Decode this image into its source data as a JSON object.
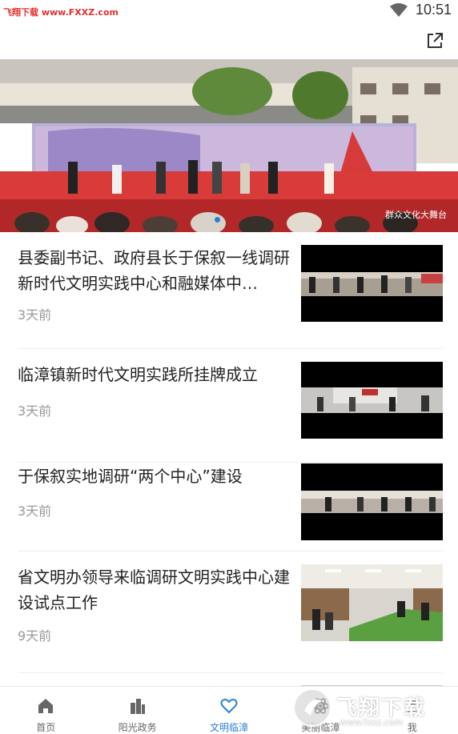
{
  "status_bar": {
    "watermark": "飞翔下载 www.FXXZ.com",
    "time": "10:51"
  },
  "banner": {
    "caption": "群众文化大舞台",
    "slides": 2,
    "active_slide": 0
  },
  "news": [
    {
      "title": "县委副书记、政府县长于保叙一线调研新时代文明实践中心和融媒体中…",
      "time": "3天前"
    },
    {
      "title": "临漳镇新时代文明实践所挂牌成立",
      "time": "3天前"
    },
    {
      "title": "于保叙实地调研“两个中心”建设",
      "time": "3天前"
    },
    {
      "title": "省文明办领导来临调研文明实践中心建设试点工作",
      "time": "9天前"
    }
  ],
  "tabs": [
    {
      "label": "首页",
      "icon": "home-icon"
    },
    {
      "label": "阳光政务",
      "icon": "buildings-icon"
    },
    {
      "label": "文明临漳",
      "icon": "heart-icon",
      "active": true
    },
    {
      "label": "美丽临漳",
      "icon": "atom-icon"
    },
    {
      "label": "我",
      "icon": "user-icon"
    }
  ],
  "brand_watermark": {
    "name": "飞翔下载",
    "url": "www.fxxz.com"
  },
  "colors": {
    "accent": "#2a7fd6",
    "watermark": "#e03030"
  }
}
